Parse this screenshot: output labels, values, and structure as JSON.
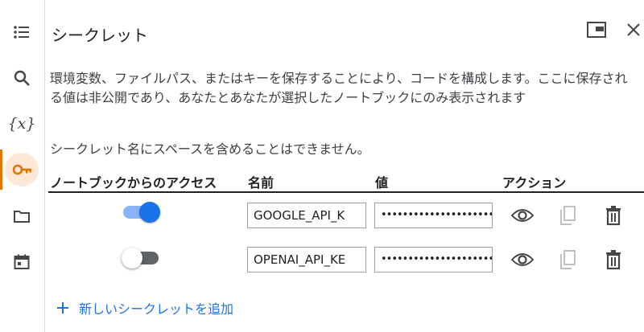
{
  "panel": {
    "title": "シークレット",
    "description": "環境変数、ファイルパス、またはキーを保存することにより、コードを構成します。ここに保存される値は非公開であり、あなたとあなたが選択したノートブックにのみ表示されます",
    "note": "シークレット名にスペースを含めることはできません。"
  },
  "sidebar": {
    "items": [
      {
        "icon": "table-of-contents-icon"
      },
      {
        "icon": "search-icon"
      },
      {
        "icon": "variables-icon",
        "glyph": "{x}"
      },
      {
        "icon": "key-icon",
        "active": true
      },
      {
        "icon": "folder-icon"
      },
      {
        "icon": "calendar-icon"
      }
    ]
  },
  "table": {
    "headers": [
      "ノートブックからのアクセス",
      "名前",
      "値",
      "アクション"
    ],
    "rows": [
      {
        "access": true,
        "name": "GOOGLE_API_K",
        "value": "••••••••••••••••••••••"
      },
      {
        "access": false,
        "name": "OPENAI_API_KE",
        "value": "••••••••••••••••••••••"
      }
    ]
  },
  "add_button": {
    "label": "新しいシークレットを追加"
  },
  "colors": {
    "accent": "#1a73e8",
    "active_rail": "#e37400"
  }
}
